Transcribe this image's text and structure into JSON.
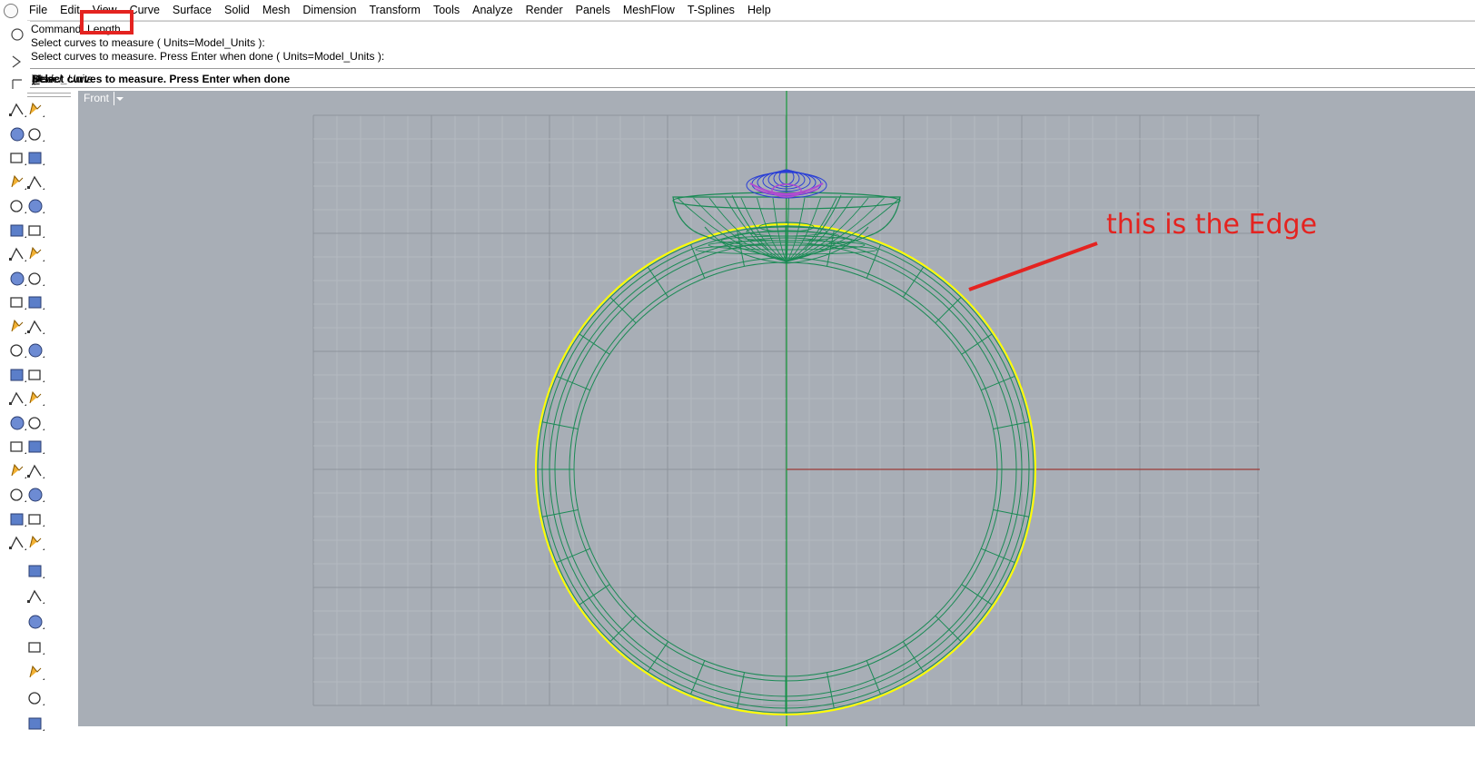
{
  "menu": {
    "items": [
      "File",
      "Edit",
      "View",
      "Curve",
      "Surface",
      "Solid",
      "Mesh",
      "Dimension",
      "Transform",
      "Tools",
      "Analyze",
      "Render",
      "Panels",
      "MeshFlow",
      "T-Splines",
      "Help"
    ]
  },
  "command": {
    "history": [
      "Command: Length",
      "Select curves to measure ( Units=Model_Units ):",
      "Select curves to measure. Press Enter when done ( Units=Model_Units ):"
    ],
    "prompt_bold": "Select curves to measure. Press Enter when done",
    "prompt_open": " ( ",
    "prompt_key": "U",
    "prompt_key_rest": "nits=",
    "prompt_value": "Model_Units",
    "prompt_close": " ):"
  },
  "viewport": {
    "name": "Front"
  },
  "annotation": {
    "text": "this is the Edge",
    "color": "#e42320"
  },
  "colors": {
    "viewport_bg": "#a8aeb6",
    "grid_minor": "#b4b9c0",
    "grid_major": "#8e949c",
    "wire": "#1b8a55",
    "edge_highlight": "#ffff00",
    "gem_blue": "#2a3fd6",
    "gem_purple": "#b04bd0",
    "x_axis": "#9b3a36",
    "y_axis": "#169b3a"
  }
}
